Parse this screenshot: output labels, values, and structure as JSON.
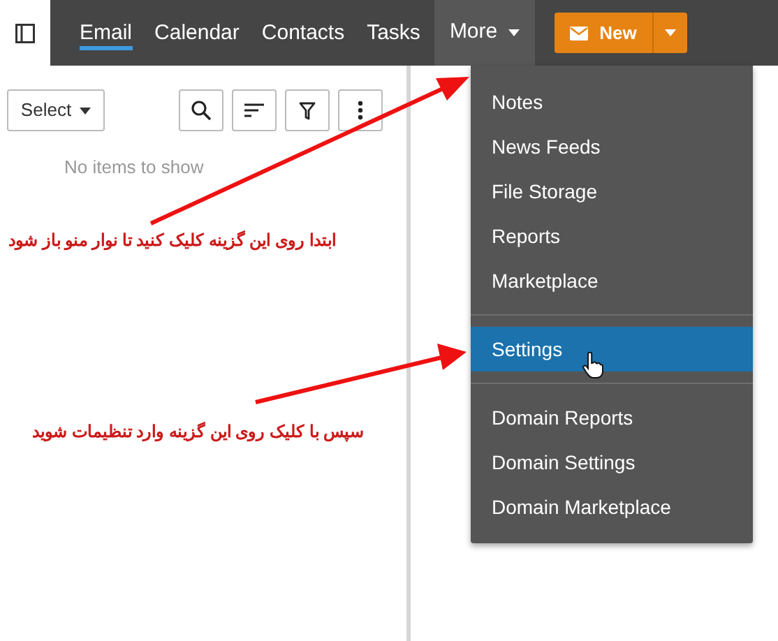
{
  "nav": {
    "tabs": [
      {
        "label": "Email",
        "selected": true
      },
      {
        "label": "Calendar",
        "selected": false
      },
      {
        "label": "Contacts",
        "selected": false
      },
      {
        "label": "Tasks",
        "selected": false
      }
    ],
    "more": {
      "label": "More",
      "expanded": true
    },
    "new_button": {
      "label": "New"
    }
  },
  "toolbar": {
    "select": "Select"
  },
  "empty_message": "No items to show",
  "menu": {
    "groups": [
      [
        {
          "label": "Notes",
          "selected": false
        },
        {
          "label": "News Feeds",
          "selected": false
        },
        {
          "label": "File Storage",
          "selected": false
        },
        {
          "label": "Reports",
          "selected": false
        },
        {
          "label": "Marketplace",
          "selected": false
        }
      ],
      [
        {
          "label": "Settings",
          "selected": true
        }
      ],
      [
        {
          "label": "Domain Reports",
          "selected": false
        },
        {
          "label": "Domain Settings",
          "selected": false
        },
        {
          "label": "Domain Marketplace",
          "selected": false
        }
      ]
    ]
  },
  "annotations": [
    {
      "text": "ابتدا روی این گزینه کلیک کنید تا نوار منو باز شود"
    },
    {
      "text": "سپس با کلیک روی این گزینه وارد تنظیمات شوید"
    }
  ]
}
